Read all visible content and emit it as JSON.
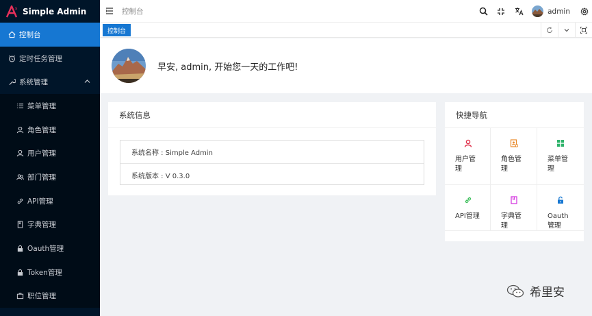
{
  "brand": {
    "title": "Simple Admin",
    "logo_letter": "A",
    "logo_color": "#e8305b"
  },
  "sidebar": {
    "items": [
      {
        "label": "控制台",
        "icon": "home-icon",
        "active": true
      },
      {
        "label": "定时任务管理",
        "icon": "clock-icon"
      },
      {
        "label": "系统管理",
        "icon": "tool-icon",
        "expanded": true
      },
      {
        "label": "菜单管理",
        "icon": "list-icon"
      },
      {
        "label": "角色管理",
        "icon": "user-icon"
      },
      {
        "label": "用户管理",
        "icon": "user-icon"
      },
      {
        "label": "部门管理",
        "icon": "users-icon"
      },
      {
        "label": "API管理",
        "icon": "link-icon"
      },
      {
        "label": "字典管理",
        "icon": "book-icon"
      },
      {
        "label": "Oauth管理",
        "icon": "lock-icon"
      },
      {
        "label": "Token管理",
        "icon": "lock-icon"
      },
      {
        "label": "职位管理",
        "icon": "briefcase-icon"
      }
    ]
  },
  "header": {
    "breadcrumb": "控制台",
    "username": "admin"
  },
  "tabs": {
    "active": "控制台"
  },
  "welcome": {
    "greeting": "早安, admin, 开始您一天的工作吧!"
  },
  "sysinfo": {
    "title": "系统信息",
    "name_row": "系统名称 : Simple Admin",
    "version_row": "系统版本 : V 0.3.0"
  },
  "quicknav": {
    "title": "快捷导航",
    "items": [
      {
        "label": "用户管理",
        "icon": "user-icon",
        "color": "#e0304a"
      },
      {
        "label": "角色管理",
        "icon": "id-card-icon",
        "color": "#e8892a"
      },
      {
        "label": "菜单管理",
        "icon": "grid-icon",
        "color": "#2fb36b"
      },
      {
        "label": "API管理",
        "icon": "link-icon",
        "color": "#3cbf5a"
      },
      {
        "label": "字典管理",
        "icon": "book-icon",
        "color": "#d63be0"
      },
      {
        "label": "Oauth管理",
        "icon": "unlock-icon",
        "color": "#1677d2"
      }
    ]
  },
  "watermark": {
    "text": "希里安"
  },
  "colors": {
    "accent": "#1677d2",
    "sidebar_bg": "#001529"
  }
}
